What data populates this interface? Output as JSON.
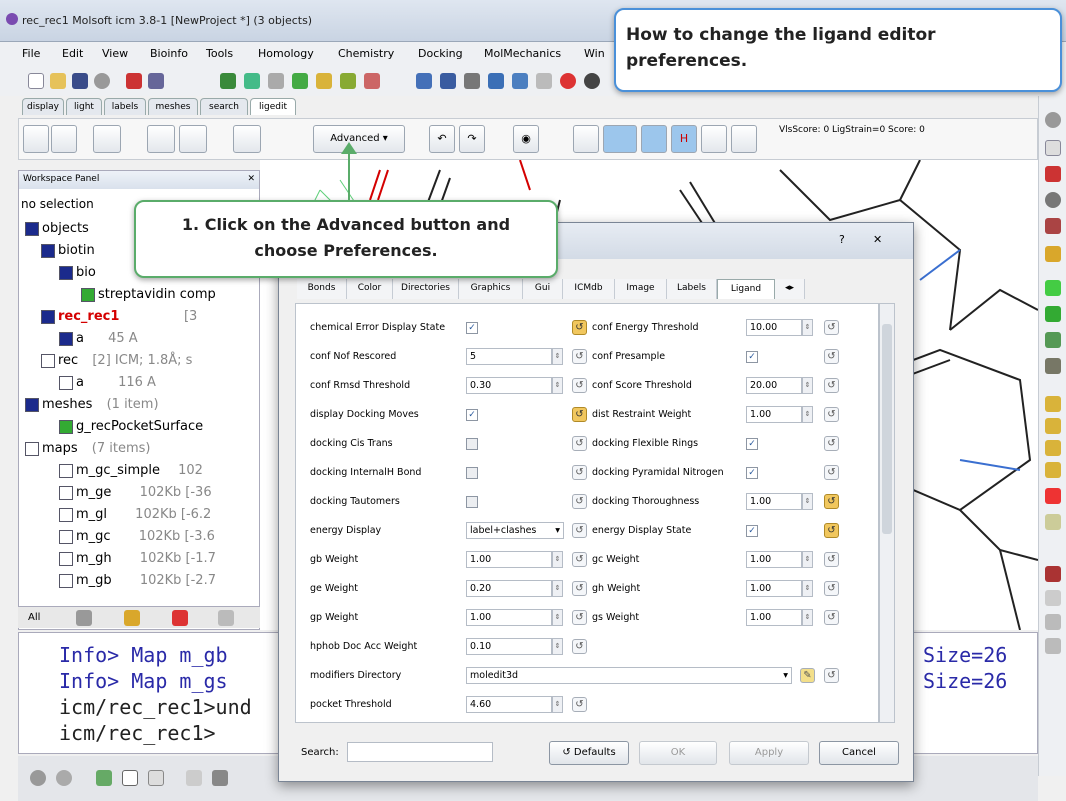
{
  "app": {
    "title": "rec_rec1 Molsoft icm 3.8-1  [NewProject *] (3 objects)"
  },
  "menu": [
    "File",
    "Edit",
    "View",
    "Bioinfo",
    "Tools",
    "Homology",
    "Chemistry",
    "Docking",
    "MolMechanics",
    "Win"
  ],
  "tabs": [
    "display",
    "light",
    "labels",
    "meshes",
    "search",
    "ligedit"
  ],
  "toolbar2": {
    "advanced_label": "Advanced",
    "scores": "VlsScore: 0 LigStrain=0 Score: 0"
  },
  "workspace": {
    "title": "Workspace Panel",
    "no_selection": "no selection",
    "tree": [
      {
        "label": "objects",
        "extra": ""
      },
      {
        "label": "biotin",
        "extra": ""
      },
      {
        "label": "bio",
        "extra": ""
      },
      {
        "label": "streptavidin comp",
        "extra": ""
      },
      {
        "label": "rec_rec1",
        "extra": "[3"
      },
      {
        "label": "a",
        "extra": "45 A"
      },
      {
        "label": "rec",
        "extra": "[2] ICM; 1.8Å; s"
      },
      {
        "label": "a",
        "extra": "116 A"
      },
      {
        "label": "meshes",
        "extra": "(1 item)"
      },
      {
        "label": "g_recPocketSurface",
        "extra": ""
      },
      {
        "label": "maps",
        "extra": "(7 items)"
      },
      {
        "label": "m_gc_simple",
        "extra": "102"
      },
      {
        "label": "m_ge",
        "extra": "102Kb [-36"
      },
      {
        "label": "m_gl",
        "extra": "102Kb [-6.2"
      },
      {
        "label": "m_gc",
        "extra": "102Kb [-3.6"
      },
      {
        "label": "m_gh",
        "extra": "102Kb [-1.7"
      },
      {
        "label": "m_gb",
        "extra": "102Kb [-2.7"
      }
    ],
    "bottom_tab": "All"
  },
  "terminal": {
    "lines": [
      "Info> Map m_gb",
      "Info> Map m_gs",
      "icm/rec_rec1>und",
      "icm/rec_rec1>"
    ],
    "right_lines": [
      "Size=26",
      "Size=26"
    ]
  },
  "dialog": {
    "tabs": [
      "Bonds",
      "Color",
      "Directories",
      "Graphics",
      "Gui",
      "ICMdb",
      "Image",
      "Labels",
      "Ligand"
    ],
    "active_tab": "Ligand",
    "left": [
      {
        "label": "chemical Error Display State",
        "kind": "check",
        "value": "✓"
      },
      {
        "label": "conf Nof Rescored",
        "kind": "num",
        "value": "5"
      },
      {
        "label": "conf Rmsd Threshold",
        "kind": "num",
        "value": "0.30"
      },
      {
        "label": "display Docking Moves",
        "kind": "check",
        "value": "✓"
      },
      {
        "label": "docking Cis Trans",
        "kind": "check",
        "value": ""
      },
      {
        "label": "docking InternalH Bond",
        "kind": "check",
        "value": ""
      },
      {
        "label": "docking Tautomers",
        "kind": "check",
        "value": ""
      },
      {
        "label": "energy Display",
        "kind": "combo",
        "value": "label+clashes"
      },
      {
        "label": "gb Weight",
        "kind": "num",
        "value": "1.00"
      },
      {
        "label": "ge Weight",
        "kind": "num",
        "value": "0.20"
      },
      {
        "label": "gp Weight",
        "kind": "num",
        "value": "1.00"
      },
      {
        "label": "hphob Doc Acc Weight",
        "kind": "num",
        "value": "0.10"
      }
    ],
    "right": [
      {
        "label": "conf Energy Threshold",
        "kind": "num",
        "value": "10.00"
      },
      {
        "label": "conf Presample",
        "kind": "check",
        "value": "✓"
      },
      {
        "label": "conf Score Threshold",
        "kind": "num",
        "value": "20.00"
      },
      {
        "label": "dist Restraint Weight",
        "kind": "num",
        "value": "1.00"
      },
      {
        "label": "docking Flexible Rings",
        "kind": "check",
        "value": "✓"
      },
      {
        "label": "docking Pyramidal Nitrogen",
        "kind": "check",
        "value": "✓"
      },
      {
        "label": "docking Thoroughness",
        "kind": "num",
        "value": "1.00"
      },
      {
        "label": "energy Display State",
        "kind": "check",
        "value": "✓"
      },
      {
        "label": "gc Weight",
        "kind": "num",
        "value": "1.00"
      },
      {
        "label": "gh Weight",
        "kind": "num",
        "value": "1.00"
      },
      {
        "label": "gs Weight",
        "kind": "num",
        "value": "1.00"
      }
    ],
    "modifiers_label": "modifiers Directory",
    "modifiers_value": "moledit3d",
    "pocket_label": "pocket Threshold",
    "pocket_value": "4.60",
    "search_label": "Search:",
    "buttons": {
      "defaults": "Defaults",
      "ok": "OK",
      "apply": "Apply",
      "cancel": "Cancel"
    }
  },
  "callouts": {
    "top": "How to change the ligand editor preferences.",
    "step1": "1. Click on the Advanced button and choose Preferences."
  },
  "colors": {
    "accent_blue": "#1b2a8c",
    "callout_border": "#5aac6a",
    "top_callout_border": "#4a90d9",
    "red": "#d40000"
  }
}
